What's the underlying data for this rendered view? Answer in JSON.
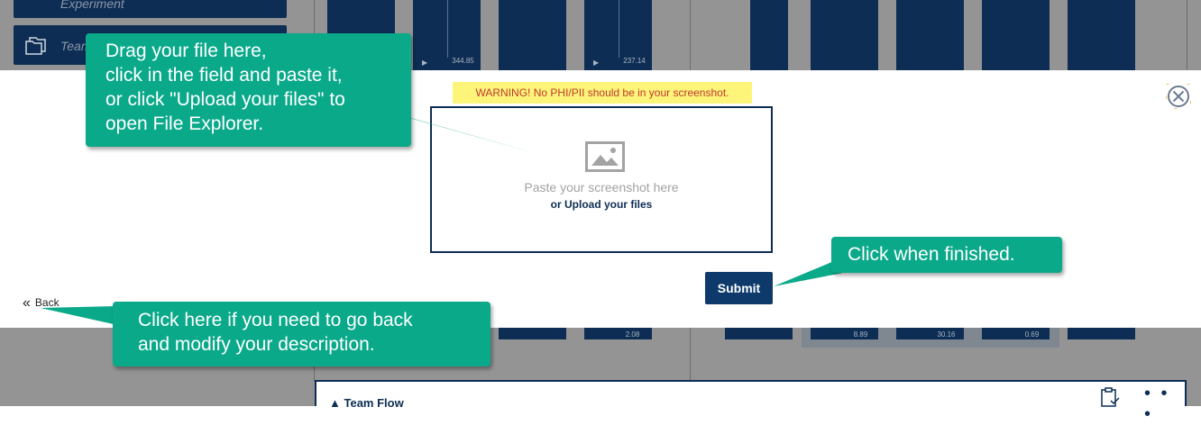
{
  "background": {
    "sidebar": [
      "Experiment",
      "Team"
    ],
    "panel_values": [
      "344.85",
      "237.14",
      "2.08",
      "8.89",
      "30.16",
      "0.69"
    ],
    "bottom_section_title": "Team Flow",
    "bottom_menu": "• • •"
  },
  "modal": {
    "warning": "WARNING! No PHI/PII should be in your screenshot.",
    "paste_text": "Paste your screenshot here",
    "upload_link": "or Upload your files",
    "submit_label": "Submit",
    "back_label": "Back"
  },
  "callouts": {
    "drag_lines": [
      "Drag your file here,",
      "click in the field and paste it,",
      "or click \"Upload your files\" to",
      "open File Explorer."
    ],
    "finished": "Click when finished.",
    "back_lines": [
      "Click here if you need to go back",
      "and modify your description."
    ]
  },
  "icons": {
    "image": "image-placeholder-icon",
    "close": "close-circle-icon",
    "back": "double-chevron-left-icon",
    "clipboard": "clipboard-check-icon",
    "folder": "folder-stack-icon"
  },
  "colors": {
    "navy": "#0d2d54",
    "callout": "#0aa98a",
    "warning_bg": "#fdf57a",
    "warning_text": "#c0392b"
  }
}
